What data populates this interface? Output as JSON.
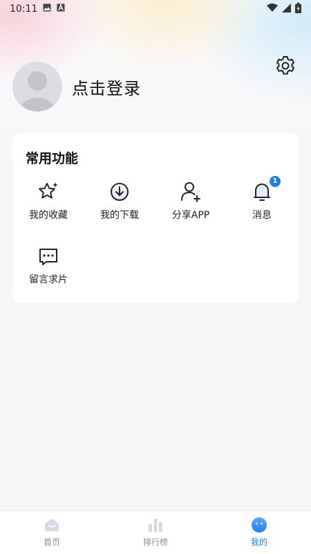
{
  "status_bar": {
    "time": "10:11"
  },
  "profile": {
    "login_label": "点击登录"
  },
  "functions": {
    "title": "常用功能",
    "items": [
      {
        "label": "我的收藏",
        "icon": "star-sparkle-icon"
      },
      {
        "label": "我的下载",
        "icon": "download-icon"
      },
      {
        "label": "分享APP",
        "icon": "add-user-icon"
      },
      {
        "label": "消息",
        "icon": "bell-icon",
        "badge": "1"
      },
      {
        "label": "留言求片",
        "icon": "chat-bubble-icon"
      }
    ]
  },
  "tabbar": {
    "items": [
      {
        "label": "首页",
        "icon": "home-icon",
        "active": false
      },
      {
        "label": "排行榜",
        "icon": "bar-chart-icon",
        "active": false
      },
      {
        "label": "我的",
        "icon": "smiley-icon",
        "active": true
      }
    ]
  },
  "colors": {
    "accent": "#1f7ff0",
    "avatar_bg": "#dcdde0",
    "tab_inactive": "#8a8d94"
  }
}
